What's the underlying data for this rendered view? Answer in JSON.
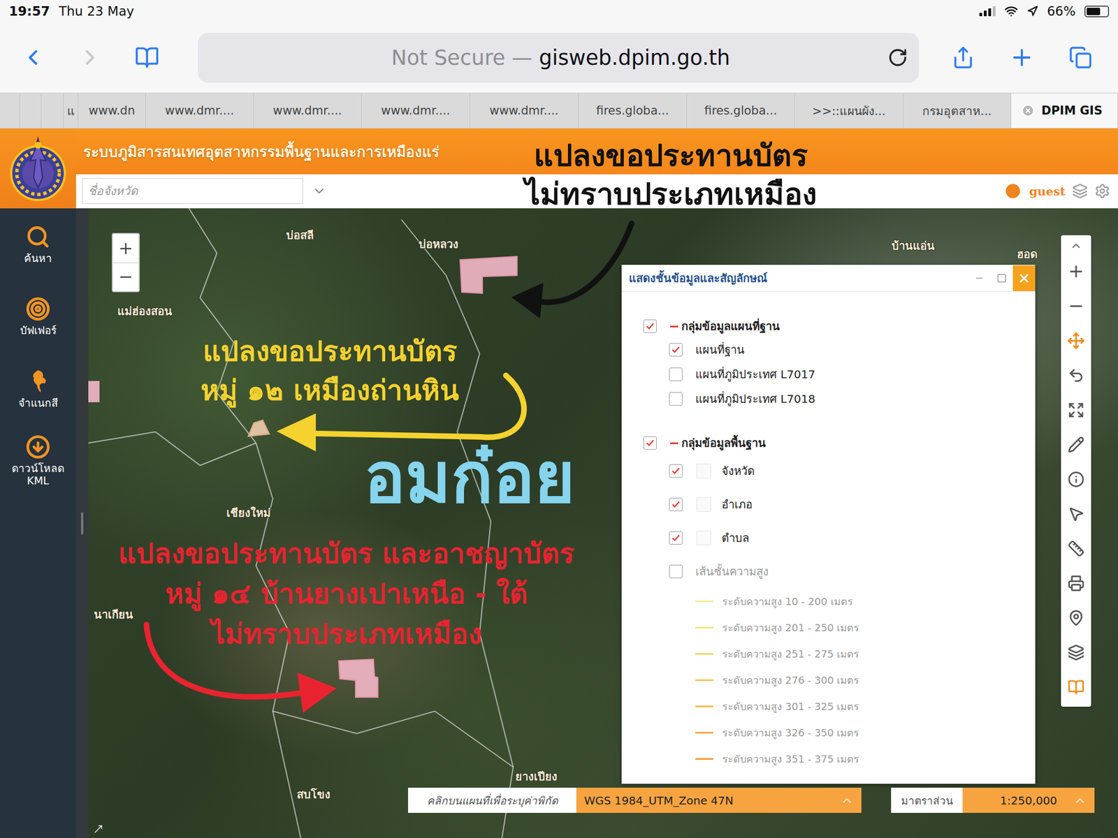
{
  "status_bar": {
    "time": "19:57",
    "date": "Thu 23 May",
    "battery": "66%",
    "battery_level": 0.66,
    "signal_level": 0.75
  },
  "browser": {
    "url_prefix": "Not Secure — ",
    "url": "gisweb.dpim.go.th",
    "back_enabled": true,
    "forward_enabled": false
  },
  "tabs": [
    {
      "label": "",
      "selected": false
    },
    {
      "label": "",
      "selected": false
    },
    {
      "label": "",
      "selected": false
    },
    {
      "label": "แ",
      "selected": false
    },
    {
      "label": "www.dn",
      "selected": false
    },
    {
      "label": "www.dmr....",
      "selected": false
    },
    {
      "label": "www.dmr....",
      "selected": false
    },
    {
      "label": "www.dmr....",
      "selected": false
    },
    {
      "label": "www.dmr....",
      "selected": false
    },
    {
      "label": "fires.globa...",
      "selected": false
    },
    {
      "label": "fires.globa...",
      "selected": false
    },
    {
      "label": ">>::แผนผัง...",
      "selected": false
    },
    {
      "label": "กรมอุตสาห...",
      "selected": false
    },
    {
      "label": "DPIM GIS",
      "selected": true
    }
  ],
  "app": {
    "title": "ระบบภูมิสารสนเทศอุตสาหกรรมพื้นฐานและการเหมืองแร่",
    "province_placeholder": "ชื่อจังหวัด",
    "user": "guest"
  },
  "sidebar": {
    "items": [
      {
        "label": "ค้นหา"
      },
      {
        "label": "บัฟเฟอร์"
      },
      {
        "label": "จำแนกสี"
      },
      {
        "label": "ดาวน์โหลด KML"
      }
    ]
  },
  "map": {
    "place_labels": [
      "บ่อสลี",
      "บ่อหลวง",
      "บ้านแอ่น",
      "ฮอด",
      "แม่ฮ่องสอน",
      "เชียงใหม่",
      "นาเกียน",
      "ยางเปียง",
      "สบโขง"
    ],
    "annotations": [
      {
        "kind": "callout",
        "lines": [
          "แปลงขอประทานบัตร",
          "ไม่ทราบประเภทเหมือง"
        ],
        "color": "#111111"
      },
      {
        "kind": "callout",
        "lines": [
          "แปลงขอประทานบัตร",
          "หมู่ ๑๒ เหมืองถ่านหิน"
        ],
        "color": "#f5d22e"
      },
      {
        "kind": "label",
        "lines": [
          "อมก๋อย"
        ],
        "color": "#86d4ee"
      },
      {
        "kind": "callout",
        "lines": [
          "แปลงขอประทานบัตร และอาชญาบัตร",
          "หมู่ ๑๔ บ้านยางเปาเหนือ - ใต้",
          "ไม่ทราบประเภทเหมือง"
        ],
        "color": "#ea2330"
      }
    ]
  },
  "layer_panel": {
    "title": "แสดงชั้นข้อมูลและสัญลักษณ์",
    "groups": [
      {
        "label": "กลุ่มข้อมูลแผนที่ฐาน",
        "checked": true,
        "expanded": true,
        "items": [
          {
            "label": "แผนที่ฐาน",
            "kind": "plain",
            "checked": true,
            "disabled": false
          },
          {
            "label": "แผนที่ภูมิประเทศ L7017",
            "kind": "plain",
            "checked": false,
            "disabled": false
          },
          {
            "label": "แผนที่ภูมิประเทศ L7018",
            "kind": "plain",
            "checked": false,
            "disabled": false
          }
        ]
      },
      {
        "label": "กลุ่มข้อมูลพื้นฐาน",
        "checked": true,
        "expanded": true,
        "items": [
          {
            "label": "จังหวัด",
            "kind": "symbol",
            "checked": true,
            "disabled": false
          },
          {
            "label": "อำเภอ",
            "kind": "symbol",
            "checked": true,
            "disabled": false
          },
          {
            "label": "ตำบล",
            "kind": "symbol",
            "checked": true,
            "disabled": false
          },
          {
            "label": "เส้นชั้นความสูง",
            "kind": "plain",
            "checked": false,
            "disabled": true,
            "legend": [
              {
                "label": "ระดับความสูง 10 - 200 เมตร",
                "color": "#f6ea9a"
              },
              {
                "label": "ระดับความสูง 201 - 250 เมตร",
                "color": "#f5e27e"
              },
              {
                "label": "ระดับความสูง 251 - 275 เมตร",
                "color": "#f4d766"
              },
              {
                "label": "ระดับความสูง 276 - 300 เมตร",
                "color": "#f3ca55"
              },
              {
                "label": "ระดับความสูง 301 - 325 เมตร",
                "color": "#f2bb4a"
              },
              {
                "label": "ระดับความสูง 326 - 350 เมตร",
                "color": "#f1ab42"
              },
              {
                "label": "ระดับความสูง 351 - 375 เมตร",
                "color": "#f09b3a"
              }
            ]
          }
        ]
      }
    ]
  },
  "coordinate_bar": {
    "hint": "คลิกบนแผนที่เพื่อระบุค่าพิกัด",
    "projection": "WGS 1984_UTM_Zone 47N",
    "scale_label": "มาตราส่วน",
    "scale": "1:250,000"
  }
}
